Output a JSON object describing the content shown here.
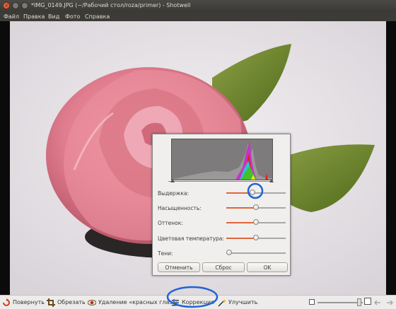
{
  "window": {
    "title": "*IMG_0149.JPG (~/Рабочий стол/roza/primer) - Shotwell",
    "close_glyph": "×"
  },
  "menu": [
    "Файл",
    "Правка",
    "Вид",
    "Фото",
    "Справка"
  ],
  "adjust_dialog": {
    "sliders": [
      {
        "label": "Выдержка:",
        "value": 0.44
      },
      {
        "label": "Насыщенность:",
        "value": 0.5
      },
      {
        "label": "Оттенок:",
        "value": 0.5
      },
      {
        "label": "Цветовая температура:",
        "value": 0.5
      },
      {
        "label": "Тени:",
        "value": 0.05
      }
    ],
    "buttons": {
      "cancel": "Отменить",
      "reset": "Сброс",
      "ok": "OK"
    },
    "accent_color": "#e0663a"
  },
  "toolbar": {
    "rotate": "Повернуть",
    "crop": "Обрезать",
    "redeye": "Удаление «красных глаз»",
    "adjust": "Коррекция",
    "enhance": "Улучшить",
    "icons": [
      "rotate-icon",
      "crop-icon",
      "redeye-icon",
      "adjust-icon",
      "enhance-icon",
      "zoom-out-icon",
      "zoom-in-icon",
      "prev-arrow-icon",
      "next-arrow-icon"
    ]
  }
}
